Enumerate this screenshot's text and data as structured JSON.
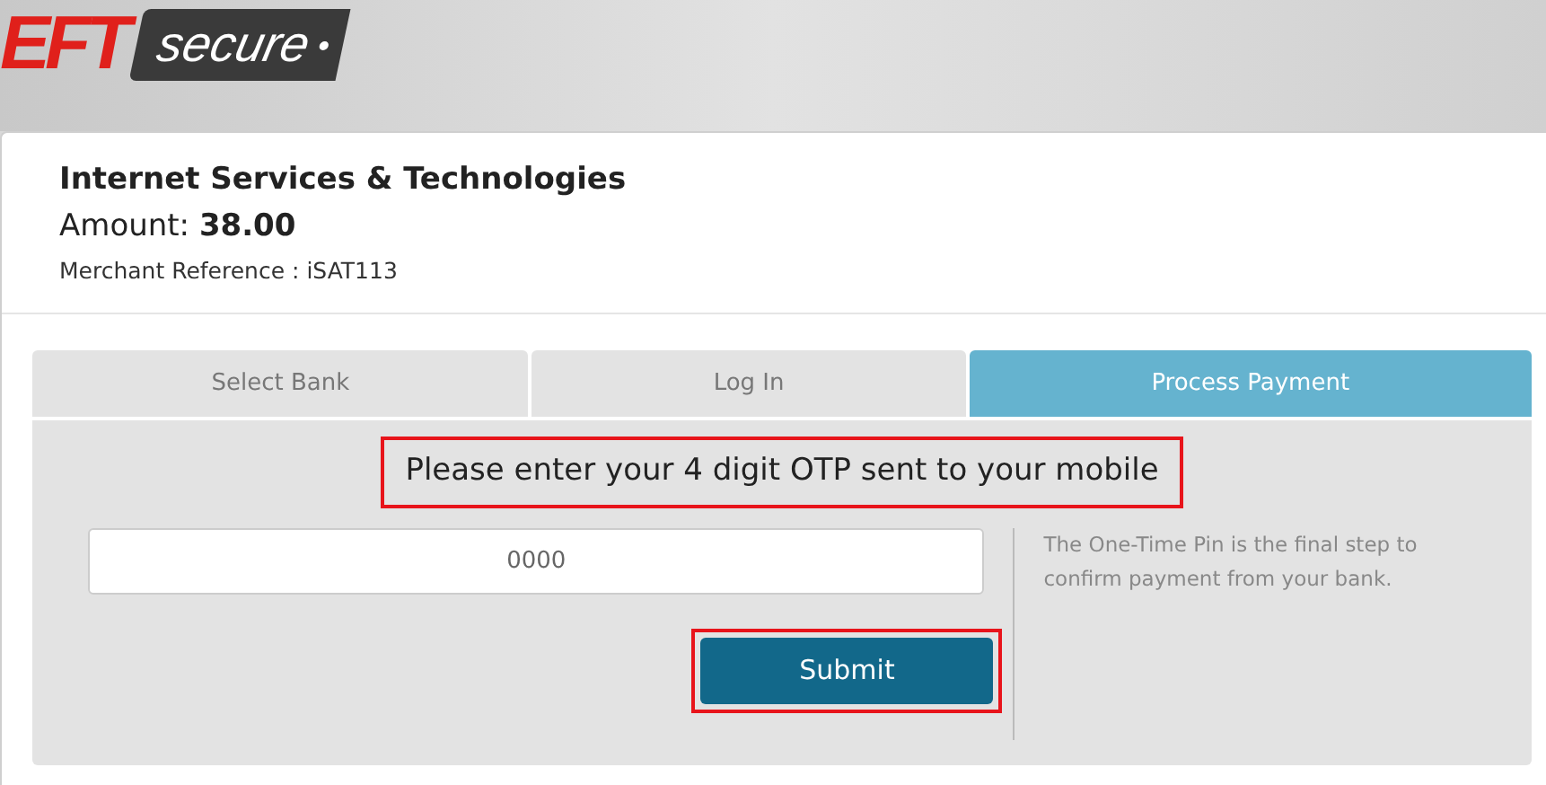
{
  "logo": {
    "mark": "EFT",
    "tag": "secure"
  },
  "merchant": {
    "name": "Internet Services & Technologies",
    "amount_label": "Amount:",
    "amount": "38.00",
    "reference": "Merchant Reference : iSAT113"
  },
  "tabs": [
    {
      "label": "Select Bank",
      "selected": false
    },
    {
      "label": "Log In",
      "selected": false
    },
    {
      "label": "Process Payment",
      "selected": true
    }
  ],
  "otp": {
    "prompt": "Please enter your 4 digit OTP sent to your mobile",
    "prompt_highlighted": true,
    "placeholder": "0000",
    "submit": "Submit",
    "submit_highlighted": true,
    "help": "The One-Time Pin is the final step to confirm payment from your bank."
  }
}
